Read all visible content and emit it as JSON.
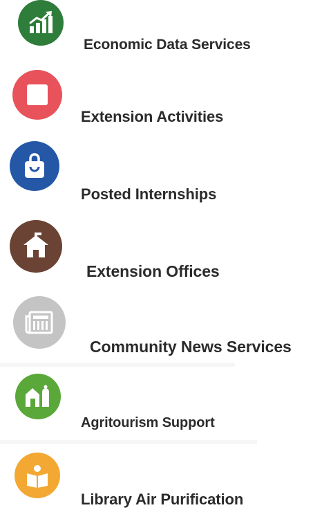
{
  "items": [
    {
      "label": "Economic Data Services",
      "icon": "chart-growth-icon",
      "color": "#2e7d3a"
    },
    {
      "label": "Extension Activities",
      "icon": "square-icon",
      "color": "#e8525b"
    },
    {
      "label": "Posted Internships",
      "icon": "shopping-bag-icon",
      "color": "#2457a6"
    },
    {
      "label": "Extension Offices",
      "icon": "schoolhouse-icon",
      "color": "#6b4334"
    },
    {
      "label": "Community News Services",
      "icon": "newspaper-icon",
      "color": "#c4c4c4"
    },
    {
      "label": "Agritourism Support",
      "icon": "barn-silo-icon",
      "color": "#5aa83a"
    },
    {
      "label": "Library Air Purification",
      "icon": "open-book-reader-icon",
      "color": "#f2a832"
    }
  ]
}
